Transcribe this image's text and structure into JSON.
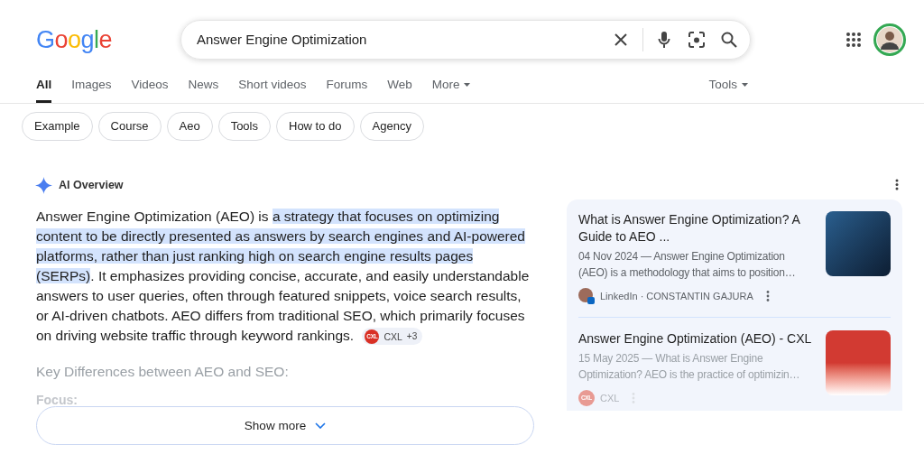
{
  "logo": "Google",
  "search": {
    "value": "Answer Engine Optimization"
  },
  "tabs": [
    {
      "label": "All",
      "selected": true
    },
    {
      "label": "Images",
      "selected": false
    },
    {
      "label": "Videos",
      "selected": false
    },
    {
      "label": "News",
      "selected": false
    },
    {
      "label": "Short videos",
      "selected": false
    },
    {
      "label": "Forums",
      "selected": false
    },
    {
      "label": "Web",
      "selected": false
    },
    {
      "label": "More",
      "selected": false,
      "dropdown": true
    }
  ],
  "tools": "Tools",
  "chips": [
    "Example",
    "Course",
    "Aeo",
    "Tools",
    "How to do",
    "Agency"
  ],
  "ai_overview": {
    "title": "AI Overview",
    "summary": [
      {
        "text": "Answer Engine Optimization (AEO) is ",
        "highlighted": false
      },
      {
        "text": "a strategy that focuses on optimizing content to be directly presented as answers by search engines and AI-powered platforms, rather than just ranking high on search engine results pages (SERPs)",
        "highlighted": true
      },
      {
        "text": ". It emphasizes providing concise, accurate, and easily understandable answers to user queries, often through featured snippets, voice search results, or AI-driven chatbots. AEO differs from traditional SEO, which primarily focuses on driving website traffic through keyword rankings.",
        "highlighted": false
      }
    ],
    "citation": {
      "source": "CXL",
      "badge": "CXL",
      "more": "+3"
    },
    "heading": "Key Differences between AEO and SEO:",
    "subheading": "Focus:",
    "show_more": "Show more"
  },
  "sources": [
    {
      "title": "What is Answer Engine Optimization? A Guide to AEO ...",
      "snippet": "04 Nov 2024 — Answer Engine Optimization (AEO) is a methodology that aims to position…",
      "site": "LinkedIn · CONSTANTIN GAJURA",
      "kind": "person",
      "faded": false
    },
    {
      "title": "Answer Engine Optimization (AEO) - CXL",
      "snippet": "15 May 2025 — What is Answer Engine Optimization? AEO is the practice of optimizin…",
      "site": "CXL",
      "kind": "brand",
      "badge": "CXL",
      "faded": true
    }
  ]
}
